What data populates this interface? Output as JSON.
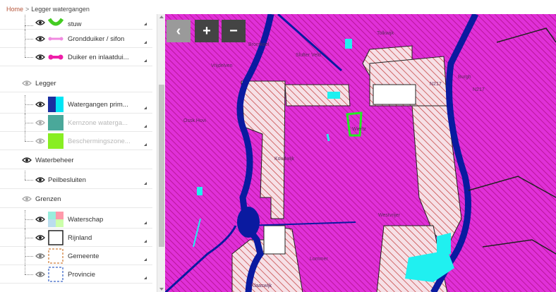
{
  "breadcrumb": {
    "home": "Home",
    "separator": ">",
    "current": "Legger watergangen"
  },
  "layers": {
    "stuw": {
      "label": "stuw",
      "icon": "green-arc-icon",
      "color": "#44cc22"
    },
    "grondduiker": {
      "label": "Grondduiker / sifon",
      "icon": "pink-line-icon",
      "color": "#f08ae0"
    },
    "duiker": {
      "label": "Duiker en inlaatdui...",
      "icon": "magenta-bar-icon",
      "color": "#ee1ea8"
    },
    "legger_group": {
      "label": "Legger"
    },
    "watergangen": {
      "label": "Watergangen prim...",
      "colors": [
        "#1a2fa0",
        "#00e5f5"
      ]
    },
    "kernzone": {
      "label": "Kernzone waterga...",
      "color": "#4aa89a"
    },
    "bescherming": {
      "label": "Beschermingszone...",
      "color": "#88ee22"
    },
    "waterbeheer_group": {
      "label": "Waterbeheer"
    },
    "peilbesluiten": {
      "label": "Peilbesluiten"
    },
    "grenzen_group": {
      "label": "Grenzen"
    },
    "waterschap": {
      "label": "Waterschap"
    },
    "rijnland": {
      "label": "Rijnland",
      "color": "#222222"
    },
    "gemeente": {
      "label": "Gemeente",
      "color": "#d9935a"
    },
    "provincie": {
      "label": "Provincie",
      "color": "#5a7fd0"
    }
  },
  "map": {
    "buttons": {
      "back": "‹",
      "zoom_in": "+",
      "zoom_out": "−"
    },
    "labels": [
      "Tolkwijk",
      "Bromkoel",
      "Slufter Veld",
      "Vrijdelven",
      "Ossk Hovi",
      "Koudwijk",
      "Lommer",
      "Westvrijer",
      "Wiertz",
      "N217",
      "N217",
      "Burgh",
      "Klaaswijk"
    ],
    "colors": {
      "land": "#e030d8",
      "hatch": "#c01090",
      "water": "#0a1aa0",
      "cyan": "#20f0f0",
      "parcel": "#c84a4a"
    }
  }
}
